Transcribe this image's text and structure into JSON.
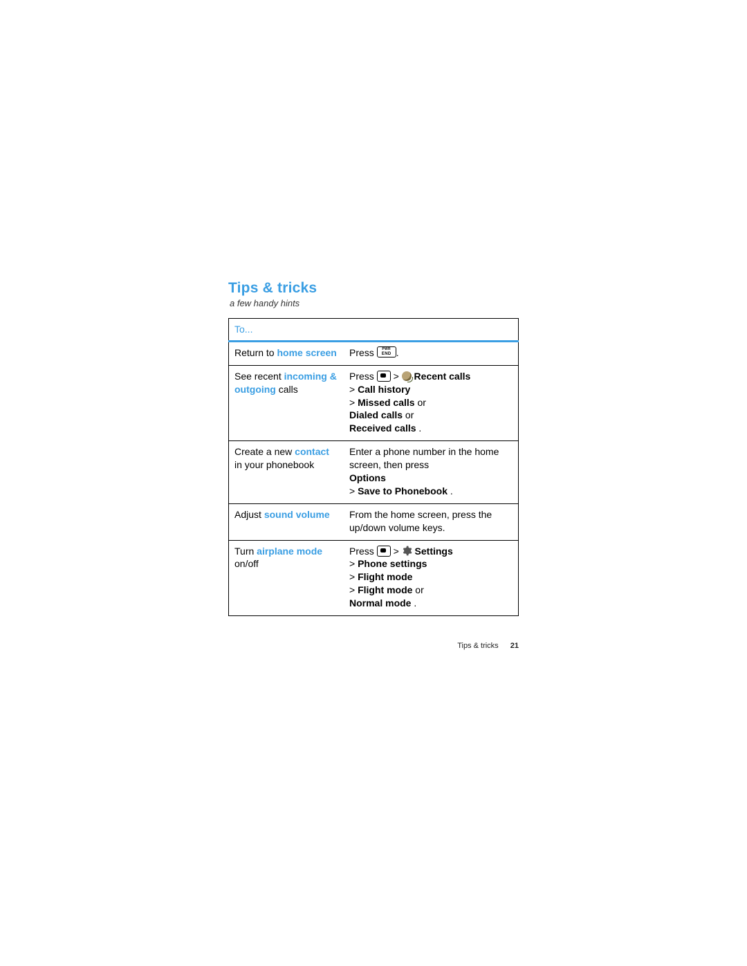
{
  "section": {
    "title": "Tips & tricks",
    "subtitle": "a few handy hints"
  },
  "table": {
    "header": "To...",
    "rows": [
      {
        "left_pre": "Return to ",
        "left_hl": "home screen",
        "left_post": "",
        "right_pre": "Press ",
        "right_post": ".",
        "icons": "end"
      },
      {
        "left_pre": "See recent ",
        "left_hl": "incoming & outgoing",
        "left_post": " calls",
        "right_press_label": "Press ",
        "right_after_icons": " Recent calls",
        "right_l2a": "> ",
        "right_l2b": "Call history",
        "right_l3a": "> ",
        "right_l3b": "Missed calls",
        "right_l3c": "  or ",
        "right_l4a": "Dialed calls",
        "right_l4b": "  or ",
        "right_l5a": "Received calls",
        "right_l5b": " .",
        "icons": "center-recent"
      },
      {
        "left_pre": "Create a new ",
        "left_hl": "contact",
        "left_post": " in your phonebook",
        "right_l1": "Enter a phone number in the home screen, then press ",
        "right_l2": "Options",
        "right_l3a": "> ",
        "right_l3b": "Save to Phonebook",
        "right_l3c": " ."
      },
      {
        "left_pre": "Adjust ",
        "left_hl": "sound volume",
        "left_post": "",
        "right_l1": "From the home screen, press the up/down volume keys."
      },
      {
        "left_pre": "Turn ",
        "left_hl": "airplane mode",
        "left_post": " on/off",
        "right_press_label": "Press ",
        "right_after_icons": " Settings",
        "right_l2a": "> ",
        "right_l2b": "Phone settings",
        "right_l3a": "> ",
        "right_l3b": "Flight mode",
        "right_l4a": "> ",
        "right_l4b": "Flight mode",
        "right_l4c": "  or ",
        "right_l5a": "Normal mode",
        "right_l5b": "  .",
        "icons": "center-gear"
      }
    ]
  },
  "footer": {
    "label": "Tips & tricks",
    "page": "21"
  }
}
